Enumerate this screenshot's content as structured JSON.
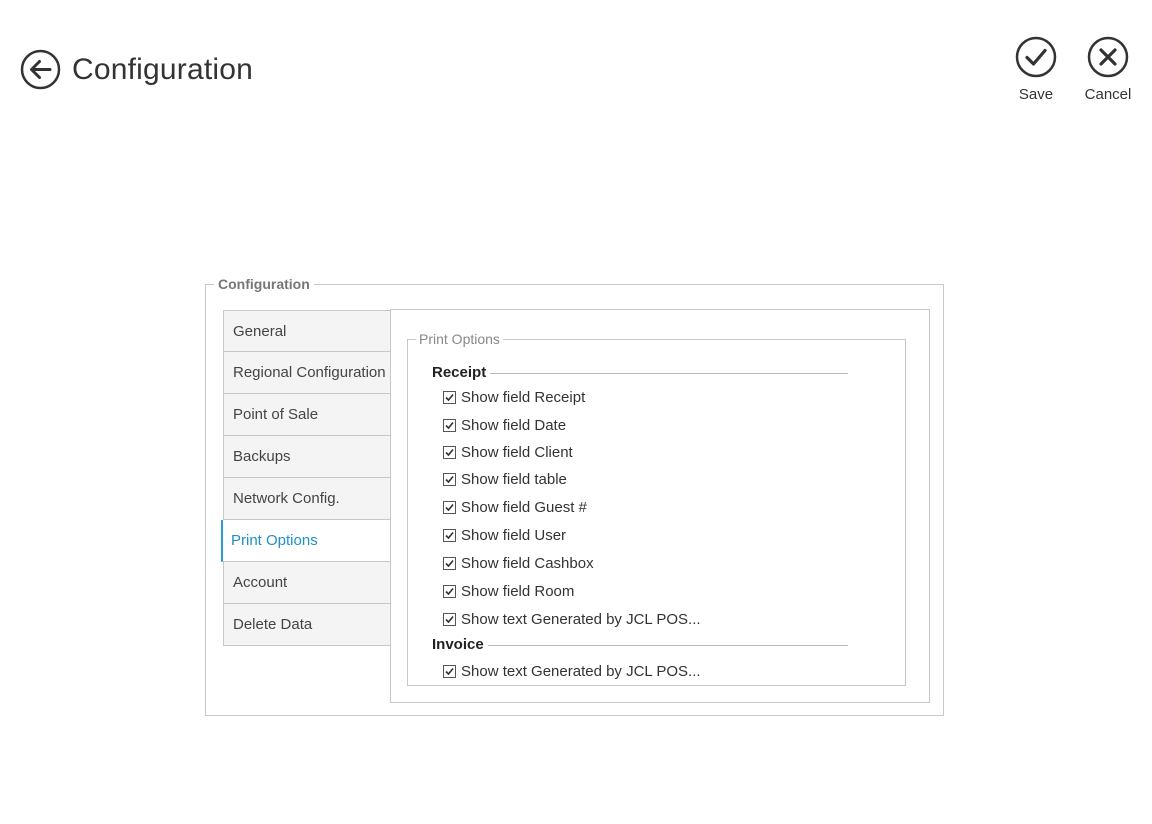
{
  "header": {
    "title": "Configuration",
    "save_label": "Save",
    "cancel_label": "Cancel"
  },
  "config": {
    "group_label": "Configuration",
    "tabs": [
      {
        "label": "General",
        "active": false
      },
      {
        "label": "Regional Configuration",
        "active": false
      },
      {
        "label": "Point of Sale",
        "active": false
      },
      {
        "label": "Backups",
        "active": false
      },
      {
        "label": "Network Config.",
        "active": false
      },
      {
        "label": "Print Options",
        "active": true
      },
      {
        "label": "Account",
        "active": false
      },
      {
        "label": "Delete Data",
        "active": false
      }
    ]
  },
  "print_options": {
    "group_label": "Print Options",
    "receipt": {
      "heading": "Receipt",
      "items": [
        {
          "label": "Show field Receipt",
          "checked": true
        },
        {
          "label": "Show field Date",
          "checked": true
        },
        {
          "label": "Show field Client",
          "checked": true
        },
        {
          "label": "Show field table",
          "checked": true
        },
        {
          "label": "Show field Guest #",
          "checked": true
        },
        {
          "label": "Show field User",
          "checked": true
        },
        {
          "label": "Show field Cashbox",
          "checked": true
        },
        {
          "label": "Show field Room",
          "checked": true
        },
        {
          "label": "Show text Generated by JCL POS...",
          "checked": true
        }
      ]
    },
    "invoice": {
      "heading": "Invoice",
      "items": [
        {
          "label": "Show text Generated by JCL POS...",
          "checked": true
        }
      ]
    }
  },
  "colors": {
    "accent": "#1f8fc5",
    "border": "#c8c8c8",
    "tab_bg": "#f4f4f4"
  }
}
